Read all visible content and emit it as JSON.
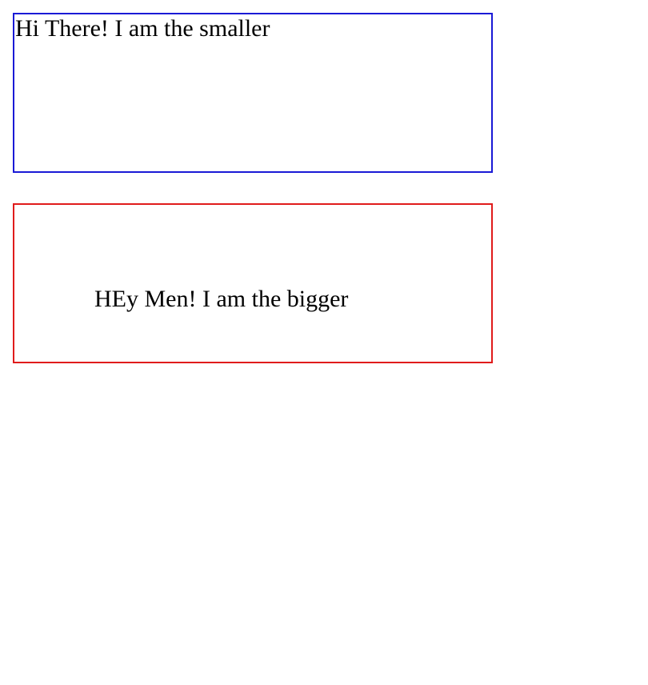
{
  "boxes": {
    "smaller": {
      "text": "Hi There! I am the smaller",
      "border_color": "#1a1ad6"
    },
    "bigger": {
      "text": "HEy Men! I am the bigger",
      "border_color": "#e01b1b"
    }
  }
}
